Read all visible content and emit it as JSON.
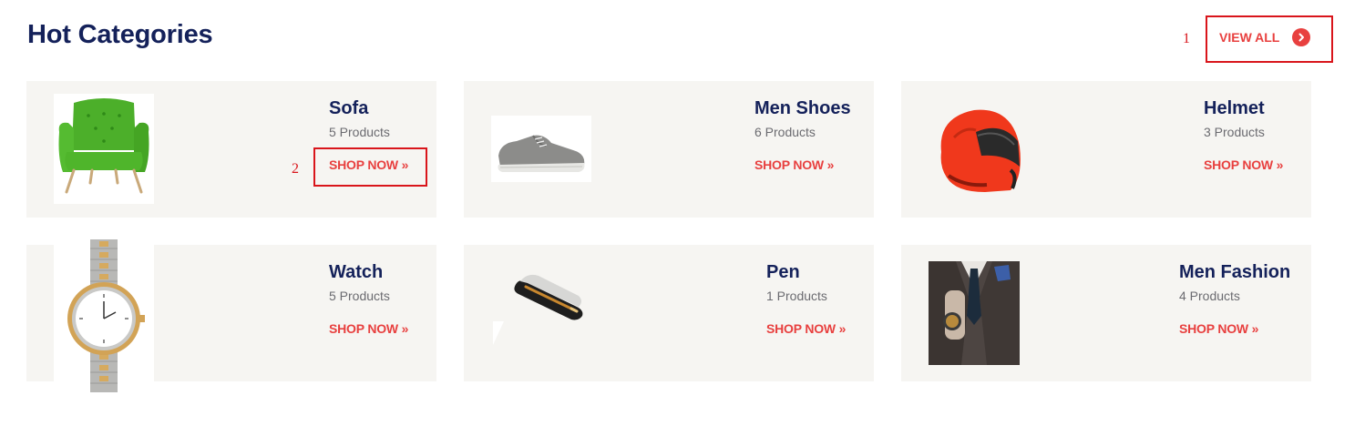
{
  "header": {
    "title": "Hot Categories",
    "view_all_label": "VIEW ALL",
    "view_all_icon": "chevron-right-icon"
  },
  "annotations": {
    "marker_1": "1",
    "marker_2": "2"
  },
  "categories": [
    {
      "name": "Sofa",
      "count": "5 Products",
      "shop_label": "SHOP NOW »",
      "image": "green-armchair"
    },
    {
      "name": "Men Shoes",
      "count": "6 Products",
      "shop_label": "SHOP NOW »",
      "image": "grey-sneaker"
    },
    {
      "name": "Helmet",
      "count": "3 Products",
      "shop_label": "SHOP NOW »",
      "image": "red-motorcycle-helmet"
    },
    {
      "name": "Watch",
      "count": "5 Products",
      "shop_label": "SHOP NOW »",
      "image": "two-tone-wristwatch"
    },
    {
      "name": "Pen",
      "count": "1 Products",
      "shop_label": "SHOP NOW »",
      "image": "pen-in-case"
    },
    {
      "name": "Men Fashion",
      "count": "4 Products",
      "shop_label": "SHOP NOW »",
      "image": "man-in-suit"
    }
  ],
  "colors": {
    "title": "#14215a",
    "accent": "#e8403f",
    "card_background": "#f6f5f2",
    "annotation": "#d9151b"
  }
}
